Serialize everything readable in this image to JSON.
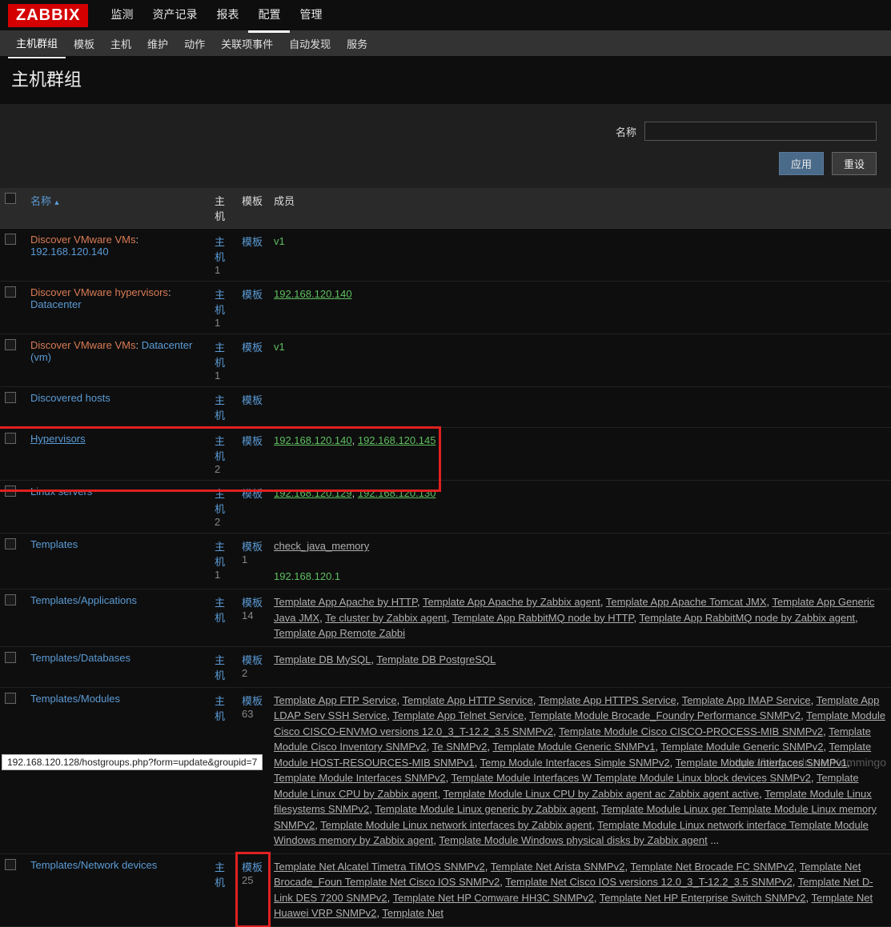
{
  "brand": "ZABBIX",
  "mainnav": [
    "监测",
    "资产记录",
    "报表",
    "配置",
    "管理"
  ],
  "mainnav_active": 3,
  "subnav": [
    "主机群组",
    "模板",
    "主机",
    "维护",
    "动作",
    "关联项事件",
    "自动发现",
    "服务"
  ],
  "subnav_active": 0,
  "page_title": "主机群组",
  "filter": {
    "name_label": "名称",
    "apply": "应用",
    "reset": "重设",
    "value": ""
  },
  "headers": {
    "name": "名称",
    "hosts": "主机",
    "templates": "模板",
    "members": "成员"
  },
  "rows": [
    {
      "name_parts": [
        {
          "text": "Discover VMware VMs",
          "cls": "lnk-red"
        },
        {
          "text": ": ",
          "cls": ""
        },
        {
          "text": "192.168.120.140",
          "cls": "lnk-blue"
        }
      ],
      "hosts": {
        "label": "主机",
        "cnt": "1"
      },
      "tpl": {
        "label": "模板",
        "cnt": ""
      },
      "members": [
        {
          "text": "v1",
          "cls": "lnk-green"
        }
      ]
    },
    {
      "name_parts": [
        {
          "text": "Discover VMware hypervisors",
          "cls": "lnk-red"
        },
        {
          "text": ": ",
          "cls": ""
        },
        {
          "text": "Datacenter",
          "cls": "lnk-blue"
        }
      ],
      "hosts": {
        "label": "主机",
        "cnt": "1"
      },
      "tpl": {
        "label": "模板",
        "cnt": ""
      },
      "members": [
        {
          "text": "192.168.120.140",
          "cls": "lnk-green u"
        }
      ]
    },
    {
      "name_parts": [
        {
          "text": "Discover VMware VMs",
          "cls": "lnk-red"
        },
        {
          "text": ": ",
          "cls": ""
        },
        {
          "text": "Datacenter (vm)",
          "cls": "lnk-blue"
        }
      ],
      "hosts": {
        "label": "主机",
        "cnt": "1"
      },
      "tpl": {
        "label": "模板",
        "cnt": ""
      },
      "members": [
        {
          "text": "v1",
          "cls": "lnk-green"
        }
      ]
    },
    {
      "name_parts": [
        {
          "text": "Discovered hosts",
          "cls": "lnk-blue"
        }
      ],
      "hosts": {
        "label": "主机",
        "cnt": ""
      },
      "tpl": {
        "label": "模板",
        "cnt": ""
      },
      "members": []
    },
    {
      "highlight": true,
      "name_parts": [
        {
          "text": "Hypervisors",
          "cls": "lnk-blue u"
        }
      ],
      "hosts": {
        "label": "主机",
        "cnt": "2"
      },
      "tpl": {
        "label": "模板",
        "cnt": ""
      },
      "members": [
        {
          "text": "192.168.120.140",
          "cls": "lnk-green u"
        },
        {
          "text": ", ",
          "cls": ""
        },
        {
          "text": "192.168.120.145",
          "cls": "lnk-green u"
        }
      ]
    },
    {
      "name_parts": [
        {
          "text": "Linux servers",
          "cls": "lnk-blue"
        }
      ],
      "hosts": {
        "label": "主机",
        "cnt": "2"
      },
      "tpl": {
        "label": "模板",
        "cnt": ""
      },
      "members": [
        {
          "text": "192.168.120.129",
          "cls": "lnk-green u"
        },
        {
          "text": ", ",
          "cls": ""
        },
        {
          "text": "192.168.120.130",
          "cls": "lnk-green u"
        }
      ]
    },
    {
      "name_parts": [
        {
          "text": "Templates",
          "cls": "lnk-blue"
        }
      ],
      "hosts": {
        "label": "主机",
        "cnt": "1"
      },
      "tpl": {
        "label": "模板",
        "cnt": "1"
      },
      "members": [
        {
          "text": "check_java_memory",
          "cls": "lnk-grey"
        }
      ],
      "members2": [
        {
          "text": "192.168.120.1",
          "cls": "lnk-green"
        }
      ]
    },
    {
      "name_parts": [
        {
          "text": "Templates/Applications",
          "cls": "lnk-blue"
        }
      ],
      "hosts": {
        "label": "主机",
        "cnt": ""
      },
      "tpl": {
        "label": "模板",
        "cnt": "14"
      },
      "members": [
        {
          "text": "Template App Apache by HTTP",
          "cls": "lnk-grey"
        },
        {
          "text": ", ",
          "cls": ""
        },
        {
          "text": "Template App Apache by Zabbix agent",
          "cls": "lnk-grey"
        },
        {
          "text": ", ",
          "cls": ""
        },
        {
          "text": "Template App Apache Tomcat JMX",
          "cls": "lnk-grey"
        },
        {
          "text": ", ",
          "cls": ""
        },
        {
          "text": "Template App Generic Java JMX",
          "cls": "lnk-grey"
        },
        {
          "text": ", ",
          "cls": ""
        },
        {
          "text": "Te cluster by Zabbix agent",
          "cls": "lnk-grey"
        },
        {
          "text": ", ",
          "cls": ""
        },
        {
          "text": "Template App RabbitMQ node by HTTP",
          "cls": "lnk-grey"
        },
        {
          "text": ", ",
          "cls": ""
        },
        {
          "text": "Template App RabbitMQ node by Zabbix agent",
          "cls": "lnk-grey"
        },
        {
          "text": ", ",
          "cls": ""
        },
        {
          "text": "Template App Remote Zabbi",
          "cls": "lnk-grey"
        }
      ]
    },
    {
      "name_parts": [
        {
          "text": "Templates/Databases",
          "cls": "lnk-blue"
        }
      ],
      "hosts": {
        "label": "主机",
        "cnt": ""
      },
      "tpl": {
        "label": "模板",
        "cnt": "2"
      },
      "members": [
        {
          "text": "Template DB MySQL",
          "cls": "lnk-grey"
        },
        {
          "text": ", ",
          "cls": ""
        },
        {
          "text": "Template DB PostgreSQL",
          "cls": "lnk-grey"
        }
      ]
    },
    {
      "name_parts": [
        {
          "text": "Templates/Modules",
          "cls": "lnk-blue"
        }
      ],
      "hosts": {
        "label": "主机",
        "cnt": ""
      },
      "tpl": {
        "label": "模板",
        "cnt": "63"
      },
      "members": [
        {
          "text": "Template App FTP Service",
          "cls": "lnk-grey"
        },
        {
          "text": ", ",
          "cls": ""
        },
        {
          "text": "Template App HTTP Service",
          "cls": "lnk-grey"
        },
        {
          "text": ", ",
          "cls": ""
        },
        {
          "text": "Template App HTTPS Service",
          "cls": "lnk-grey"
        },
        {
          "text": ", ",
          "cls": ""
        },
        {
          "text": "Template App IMAP Service",
          "cls": "lnk-grey"
        },
        {
          "text": ", ",
          "cls": ""
        },
        {
          "text": "Template App LDAP Serv SSH Service",
          "cls": "lnk-grey"
        },
        {
          "text": ", ",
          "cls": ""
        },
        {
          "text": "Template App Telnet Service",
          "cls": "lnk-grey"
        },
        {
          "text": ", ",
          "cls": ""
        },
        {
          "text": "Template Module Brocade_Foundry Performance SNMPv2",
          "cls": "lnk-grey"
        },
        {
          "text": ", ",
          "cls": ""
        },
        {
          "text": "Template Module Cisco CISCO-ENVMO versions 12.0_3_T-12.2_3.5 SNMPv2",
          "cls": "lnk-grey"
        },
        {
          "text": ", ",
          "cls": ""
        },
        {
          "text": "Template Module Cisco CISCO-PROCESS-MIB SNMPv2",
          "cls": "lnk-grey"
        },
        {
          "text": ", ",
          "cls": ""
        },
        {
          "text": "Template Module Cisco Inventory SNMPv2",
          "cls": "lnk-grey"
        },
        {
          "text": ", ",
          "cls": ""
        },
        {
          "text": "Te SNMPv2",
          "cls": "lnk-grey"
        },
        {
          "text": ", ",
          "cls": ""
        },
        {
          "text": "Template Module Generic SNMPv1",
          "cls": "lnk-grey"
        },
        {
          "text": ", ",
          "cls": ""
        },
        {
          "text": "Template Module Generic SNMPv2",
          "cls": "lnk-grey"
        },
        {
          "text": ", ",
          "cls": ""
        },
        {
          "text": "Template Module HOST-RESOURCES-MIB SNMPv1",
          "cls": "lnk-grey"
        },
        {
          "text": ", ",
          "cls": ""
        },
        {
          "text": "Temp Module Interfaces Simple SNMPv2",
          "cls": "lnk-grey"
        },
        {
          "text": ", ",
          "cls": ""
        },
        {
          "text": "Template Module Interfaces SNMPv1",
          "cls": "lnk-grey"
        },
        {
          "text": ", ",
          "cls": ""
        },
        {
          "text": "Template Module Interfaces SNMPv2",
          "cls": "lnk-grey"
        },
        {
          "text": ", ",
          "cls": ""
        },
        {
          "text": "Template Module Interfaces W Template Module Linux block devices SNMPv2",
          "cls": "lnk-grey"
        },
        {
          "text": ", ",
          "cls": ""
        },
        {
          "text": "Template Module Linux CPU by Zabbix agent",
          "cls": "lnk-grey"
        },
        {
          "text": ", ",
          "cls": ""
        },
        {
          "text": "Template Module Linux CPU by Zabbix agent ac Zabbix agent active",
          "cls": "lnk-grey"
        },
        {
          "text": ", ",
          "cls": ""
        },
        {
          "text": "Template Module Linux filesystems SNMPv2",
          "cls": "lnk-grey"
        },
        {
          "text": ", ",
          "cls": ""
        },
        {
          "text": "Template Module Linux generic by Zabbix agent",
          "cls": "lnk-grey"
        },
        {
          "text": ", ",
          "cls": ""
        },
        {
          "text": "Template Module Linux ger Template Module Linux memory SNMPv2",
          "cls": "lnk-grey"
        },
        {
          "text": ", ",
          "cls": ""
        },
        {
          "text": "Template Module Linux network interfaces by Zabbix agent",
          "cls": "lnk-grey"
        },
        {
          "text": ", ",
          "cls": ""
        },
        {
          "text": "Template Module Linux network interface Template Module Windows memory by Zabbix agent",
          "cls": "lnk-grey"
        },
        {
          "text": ", ",
          "cls": ""
        },
        {
          "text": "Template Module Windows physical disks by Zabbix agent",
          "cls": "lnk-grey"
        },
        {
          "text": " ...",
          "cls": ""
        }
      ]
    },
    {
      "name_parts": [
        {
          "text": "Templates/Network devices",
          "cls": "lnk-blue"
        }
      ],
      "hosts": {
        "label": "主机",
        "cnt": ""
      },
      "tpl": {
        "label": "模板",
        "cnt": "25",
        "highlight": true
      },
      "members": [
        {
          "text": "Template Net Alcatel Timetra TiMOS SNMPv2",
          "cls": "lnk-grey"
        },
        {
          "text": ", ",
          "cls": ""
        },
        {
          "text": "Template Net Arista SNMPv2",
          "cls": "lnk-grey"
        },
        {
          "text": ", ",
          "cls": ""
        },
        {
          "text": "Template Net Brocade FC SNMPv2",
          "cls": "lnk-grey"
        },
        {
          "text": ", ",
          "cls": ""
        },
        {
          "text": "Template Net Brocade_Foun Template Net Cisco IOS SNMPv2",
          "cls": "lnk-grey"
        },
        {
          "text": ", ",
          "cls": ""
        },
        {
          "text": "Template Net Cisco IOS versions 12.0_3_T-12.2_3.5 SNMPv2",
          "cls": "lnk-grey"
        },
        {
          "text": ", ",
          "cls": ""
        },
        {
          "text": "Template Net D-Link DES 7200 SNMPv2",
          "cls": "lnk-grey"
        },
        {
          "text": ", ",
          "cls": ""
        },
        {
          "text": "Template Net HP Comware HH3C SNMPv2",
          "cls": "lnk-grey"
        },
        {
          "text": ", ",
          "cls": ""
        },
        {
          "text": "Template Net HP Enterprise Switch SNMPv2",
          "cls": "lnk-grey"
        },
        {
          "text": ", ",
          "cls": ""
        },
        {
          "text": "Template Net Huawei VRP SNMPv2",
          "cls": "lnk-grey"
        },
        {
          "text": ", ",
          "cls": ""
        },
        {
          "text": "Template Net",
          "cls": "lnk-grey"
        }
      ]
    }
  ],
  "statusbar": "192.168.120.128/hostgroups.php?form=update&groupid=7",
  "watermark": "https://blog.csdn.net/Kammingo"
}
